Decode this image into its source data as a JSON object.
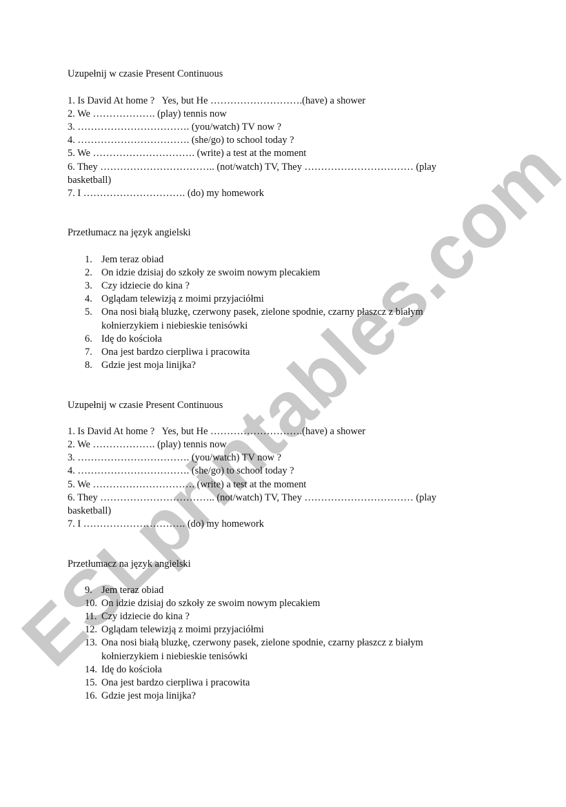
{
  "watermark": "ESLprintables.com",
  "colors": {
    "text": "#111111",
    "watermark": "#c9c9c9",
    "background": "#ffffff"
  },
  "sections": [
    {
      "heading": "Uzupełnij w czasie Present Continuous",
      "exercises": [
        "1. Is David At home ?   Yes, but He ……………………….(have) a shower",
        "2. We ………………. (play) tennis now",
        "3. ……………………………. (you/watch) TV now ?",
        "4. ……………………………. (she/go) to school today ?",
        "5. We …………………………. (write) a test at the moment",
        "6. They …………………………….. (not/watch) TV, They …………………………… (play",
        "basketball)",
        "7. I …………………………. (do) my homework"
      ]
    },
    {
      "heading": "Przetłumacz na język angielski",
      "items": [
        {
          "num": "1.",
          "text": "Jem teraz obiad"
        },
        {
          "num": "2.",
          "text": "On idzie dzisiaj do szkoły ze swoim nowym plecakiem"
        },
        {
          "num": "3.",
          "text": "Czy idziecie do kina ?"
        },
        {
          "num": "4.",
          "text": "Oglądam telewizją z moimi przyjaciółmi"
        },
        {
          "num": "5.",
          "text": "Ona nosi białą bluzkę, czerwony pasek, zielone spodnie, czarny płaszcz z białym",
          "cont": "kołnierzykiem i niebieskie tenisówki"
        },
        {
          "num": "6.",
          "text": "Idę do kościoła"
        },
        {
          "num": "7.",
          "text": "Ona jest bardzo cierpliwa i pracowita"
        },
        {
          "num": "8.",
          "text": "Gdzie jest moja linijka?"
        }
      ]
    },
    {
      "heading": "Uzupełnij w czasie Present Continuous",
      "exercises": [
        "1. Is David At home ?   Yes, but He ……………………….(have) a shower",
        "2. We ………………. (play) tennis now",
        "3. ……………………………. (you/watch) TV now ?",
        "4. ……………………………. (she/go) to school today ?",
        "5. We …………………………. (write) a test at the moment",
        "6. They …………………………….. (not/watch) TV, They …………………………… (play",
        "basketball)",
        "7. I …………………………. (do) my homework"
      ]
    },
    {
      "heading": "Przetłumacz na język angielski",
      "items": [
        {
          "num": "9.",
          "text": "Jem teraz obiad"
        },
        {
          "num": "10.",
          "text": "On idzie dzisiaj do szkoły ze swoim nowym plecakiem"
        },
        {
          "num": "11.",
          "text": "Czy idziecie do kina ?"
        },
        {
          "num": "12.",
          "text": "Oglądam telewizją z moimi przyjaciółmi"
        },
        {
          "num": "13.",
          "text": "Ona nosi białą bluzkę, czerwony pasek, zielone spodnie, czarny płaszcz z białym",
          "cont": "kołnierzykiem i niebieskie tenisówki"
        },
        {
          "num": "14.",
          "text": "Idę do kościoła"
        },
        {
          "num": "15.",
          "text": "Ona jest bardzo cierpliwa i pracowita"
        },
        {
          "num": "16.",
          "text": "Gdzie jest moja linijka?"
        }
      ]
    }
  ]
}
